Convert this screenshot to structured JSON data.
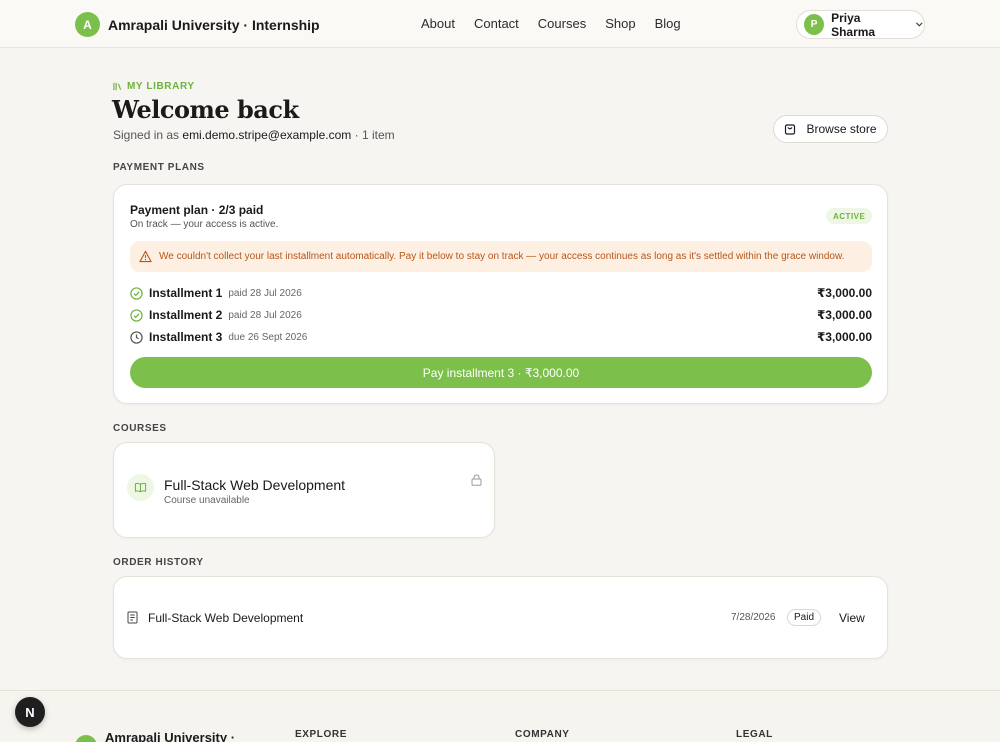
{
  "header": {
    "brand_initial": "A",
    "brand_name": "Amrapali University · Internship",
    "nav": [
      "About",
      "Contact",
      "Courses",
      "Shop",
      "Blog"
    ],
    "user_initial": "P",
    "user_name": "Priya Sharma"
  },
  "page": {
    "eyebrow": "MY LIBRARY",
    "title": "Welcome back",
    "signed_in_prefix": "Signed in as ",
    "email": "emi.demo.stripe@example.com",
    "item_count": " · 1 item",
    "browse_label": "Browse store"
  },
  "payment_plans": {
    "section_label": "PAYMENT PLANS",
    "title": "Payment plan · 2/3 paid",
    "subtitle": "On track — your access is active.",
    "status": "ACTIVE",
    "warning": "We couldn't collect your last installment automatically. Pay it below to stay on track — your access continues as long as it's settled within the grace window.",
    "installments": [
      {
        "label": "Installment 1",
        "date": "paid 28 Jul 2026",
        "amount": "₹3,000.00",
        "state": "paid"
      },
      {
        "label": "Installment 2",
        "date": "paid 28 Jul 2026",
        "amount": "₹3,000.00",
        "state": "paid"
      },
      {
        "label": "Installment 3",
        "date": "due 26 Sept 2026",
        "amount": "₹3,000.00",
        "state": "due"
      }
    ],
    "pay_button": "Pay installment 3 · ₹3,000.00"
  },
  "courses": {
    "section_label": "COURSES",
    "items": [
      {
        "title": "Full-Stack Web Development",
        "status": "Course unavailable"
      }
    ]
  },
  "orders": {
    "section_label": "ORDER HISTORY",
    "items": [
      {
        "title": "Full-Stack Web Development",
        "date": "7/28/2026",
        "status": "Paid",
        "action": "View"
      }
    ]
  },
  "footer": {
    "brand_name": "Amrapali University ·",
    "columns": [
      "EXPLORE",
      "COMPANY",
      "LEGAL"
    ]
  },
  "dev_tools_label": "N",
  "colors": {
    "accent": "#7cc04b",
    "warning_bg": "#fdf0e3",
    "warning_text": "#b8561a"
  }
}
